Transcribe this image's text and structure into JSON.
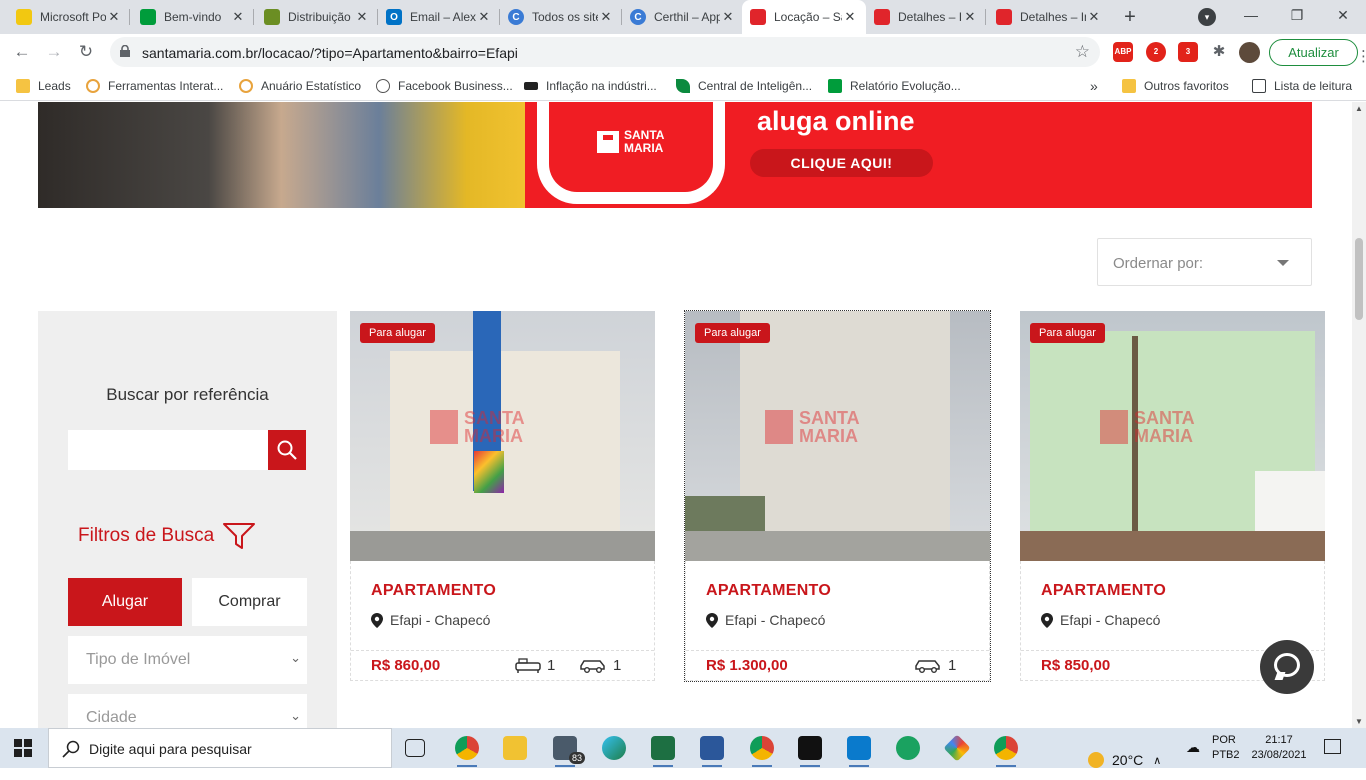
{
  "browser": {
    "tabs": [
      {
        "title": "Microsoft Power BI",
        "icon": "power-bi-icon",
        "color": "#f2c811",
        "active": false
      },
      {
        "title": "Bem-vindo",
        "icon": "flag-brazil-icon",
        "color": "#009c3b",
        "active": false
      },
      {
        "title": "Distribuição",
        "icon": "shield-crest-icon",
        "color": "#6b8e23",
        "active": false
      },
      {
        "title": "Email – Alexandre",
        "icon": "outlook-icon",
        "color": "#0072c6",
        "active": false
      },
      {
        "title": "Todos os sites",
        "icon": "c-circle-icon",
        "color": "#3a7bd5",
        "active": false
      },
      {
        "title": "Certhil – Apps",
        "icon": "c-circle-icon",
        "color": "#3a7bd5",
        "active": false
      },
      {
        "title": "Locação – Santa Maria",
        "icon": "santa-maria-icon",
        "color": "#e0252b",
        "active": true
      },
      {
        "title": "Detalhes – Imóvel",
        "icon": "santa-maria-icon",
        "color": "#e0252b",
        "active": false
      },
      {
        "title": "Detalhes – Imóvel",
        "icon": "santa-maria-icon",
        "color": "#e0252b",
        "active": false
      }
    ],
    "url": "santamaria.com.br/locacao/?tipo=Apartamento&bairro=Efapi",
    "update_label": "Atualizar",
    "extensions": [
      {
        "icon": "adblock-icon",
        "label": "ABP",
        "color": "#e2231a"
      },
      {
        "icon": "extension-badge-icon",
        "label": "2",
        "color": "#e2231a"
      },
      {
        "icon": "extension-badge-icon",
        "label": "3",
        "color": "#e2231a"
      }
    ],
    "bookmarks": [
      {
        "label": "Leads",
        "icon": "folder-icon",
        "color": "#f5c342"
      },
      {
        "label": "Ferramentas Interat...",
        "icon": "arc-icon",
        "color": "#e8a33d"
      },
      {
        "label": "Anuário Estatístico",
        "icon": "arc-icon",
        "color": "#e8a33d"
      },
      {
        "label": "Facebook Business...",
        "icon": "facebook-icon",
        "color": "#555555"
      },
      {
        "label": "Inflação na indústri...",
        "icon": "ibge-icon",
        "color": "#222222"
      },
      {
        "label": "Central de Inteligên...",
        "icon": "leaf-icon",
        "color": "#0b8a3e"
      },
      {
        "label": "Relatório Evolução...",
        "icon": "flag-brazil-icon",
        "color": "#009c3b"
      }
    ],
    "bookmarks_more": "»",
    "other_favorites": "Outros favoritos",
    "reading_list": "Lista de leitura"
  },
  "banner": {
    "brand": "SANTA MARIA",
    "aluga_text": "aluga online",
    "cta": "CLIQUE AQUI!"
  },
  "sort": {
    "placeholder": "Ordernar por:"
  },
  "sidebar": {
    "ref_title": "Buscar por referência",
    "ref_value": "",
    "filters_title": "Filtros de Busca",
    "tab_rent": "Alugar",
    "tab_buy": "Comprar",
    "select_type": "Tipo de Imóvel",
    "select_city": "Cidade"
  },
  "listings": [
    {
      "badge": "Para alugar",
      "type": "APARTAMENTO",
      "location": "Efapi - Chapecó",
      "price": "R$ 860,00",
      "bedrooms": "1",
      "parking": "1"
    },
    {
      "badge": "Para alugar",
      "type": "APARTAMENTO",
      "location": "Efapi - Chapecó",
      "price": "R$ 1.300,00",
      "bedrooms": null,
      "parking": "1"
    },
    {
      "badge": "Para alugar",
      "type": "APARTAMENTO",
      "location": "Efapi - Chapecó",
      "price": "R$ 850,00",
      "bedrooms": null,
      "parking": null
    }
  ],
  "photo_watermark": "SANTA MARIA",
  "taskbar": {
    "search_placeholder": "Digite aqui para pesquisar",
    "mail_badge": "83",
    "apps": [
      "task-view-icon",
      "chrome-icon",
      "file-explorer-icon",
      "mail-icon",
      "edge-icon",
      "excel-icon",
      "word-icon",
      "chrome-profile-icon",
      "terminal-icon",
      "vscode-icon",
      "maps-icon",
      "photos-icon",
      "chrome-alt-icon"
    ],
    "weather": "20°C",
    "lang_1": "POR",
    "lang_2": "PTB2",
    "time": "21:17",
    "date": "23/08/2021"
  },
  "colors": {
    "brand_red": "#c9161b",
    "banner_red": "#f01d23",
    "update_green": "#1e8e3e"
  }
}
